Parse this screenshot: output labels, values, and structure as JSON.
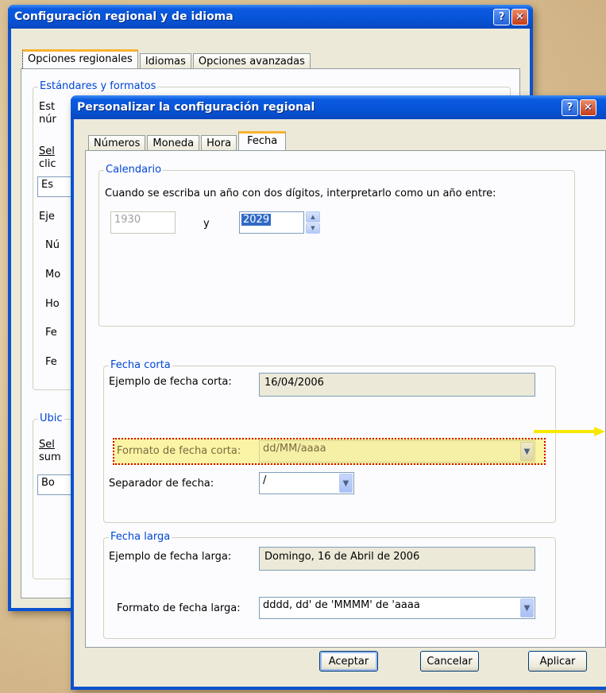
{
  "back_dialog": {
    "title": "Configuración regional y de idioma",
    "tabs": [
      "Opciones regionales",
      "Idiomas",
      "Opciones avanzadas"
    ],
    "group_standards": "Estándares y formatos",
    "clip_text": {
      "l1": "Est",
      "l2": "núr",
      "l3": "Sel",
      "l4": "clic",
      "combo": "Es",
      "ej": "Eje",
      "n": "Nú",
      "mo": "Mo",
      "ho": "Ho",
      "fe1": "Fe",
      "fe2": "Fe",
      "ubic": "Ubic",
      "sel2": "Sel",
      "sum": "sum",
      "bo": "Bo"
    }
  },
  "front_dialog": {
    "title": "Personalizar la configuración regional",
    "tabs": [
      "Números",
      "Moneda",
      "Hora",
      "Fecha"
    ],
    "calendar": {
      "legend": "Calendario",
      "text": "Cuando se escriba un año con dos dígitos, interpretarlo como un año entre:",
      "from_year": "1930",
      "and": "y",
      "to_year": "2029"
    },
    "short_date": {
      "legend": "Fecha corta",
      "example_label": "Ejemplo de fecha corta:",
      "example_value": "16/04/2006",
      "format_label": "Formato de fecha corta:",
      "format_value": "dd/MM/aaaa",
      "separator_label": "Separador de fecha:",
      "separator_value": "/"
    },
    "long_date": {
      "legend": "Fecha larga",
      "example_label": "Ejemplo de fecha larga:",
      "example_value": "Domingo, 16 de Abril de 2006",
      "format_label": "Formato de fecha larga:",
      "format_value": "dddd, dd' de 'MMMM' de 'aaaa"
    },
    "buttons": {
      "ok": "Aceptar",
      "cancel": "Cancelar",
      "apply": "Aplicar"
    }
  },
  "icons": {
    "help": "?",
    "close": "✕",
    "dropdown": "▼",
    "spin_up": "▲",
    "spin_down": "▼"
  },
  "colors": {
    "highlight": "#fbf4a4",
    "highlight_border": "#d20000",
    "arrow": "#f7e800"
  }
}
